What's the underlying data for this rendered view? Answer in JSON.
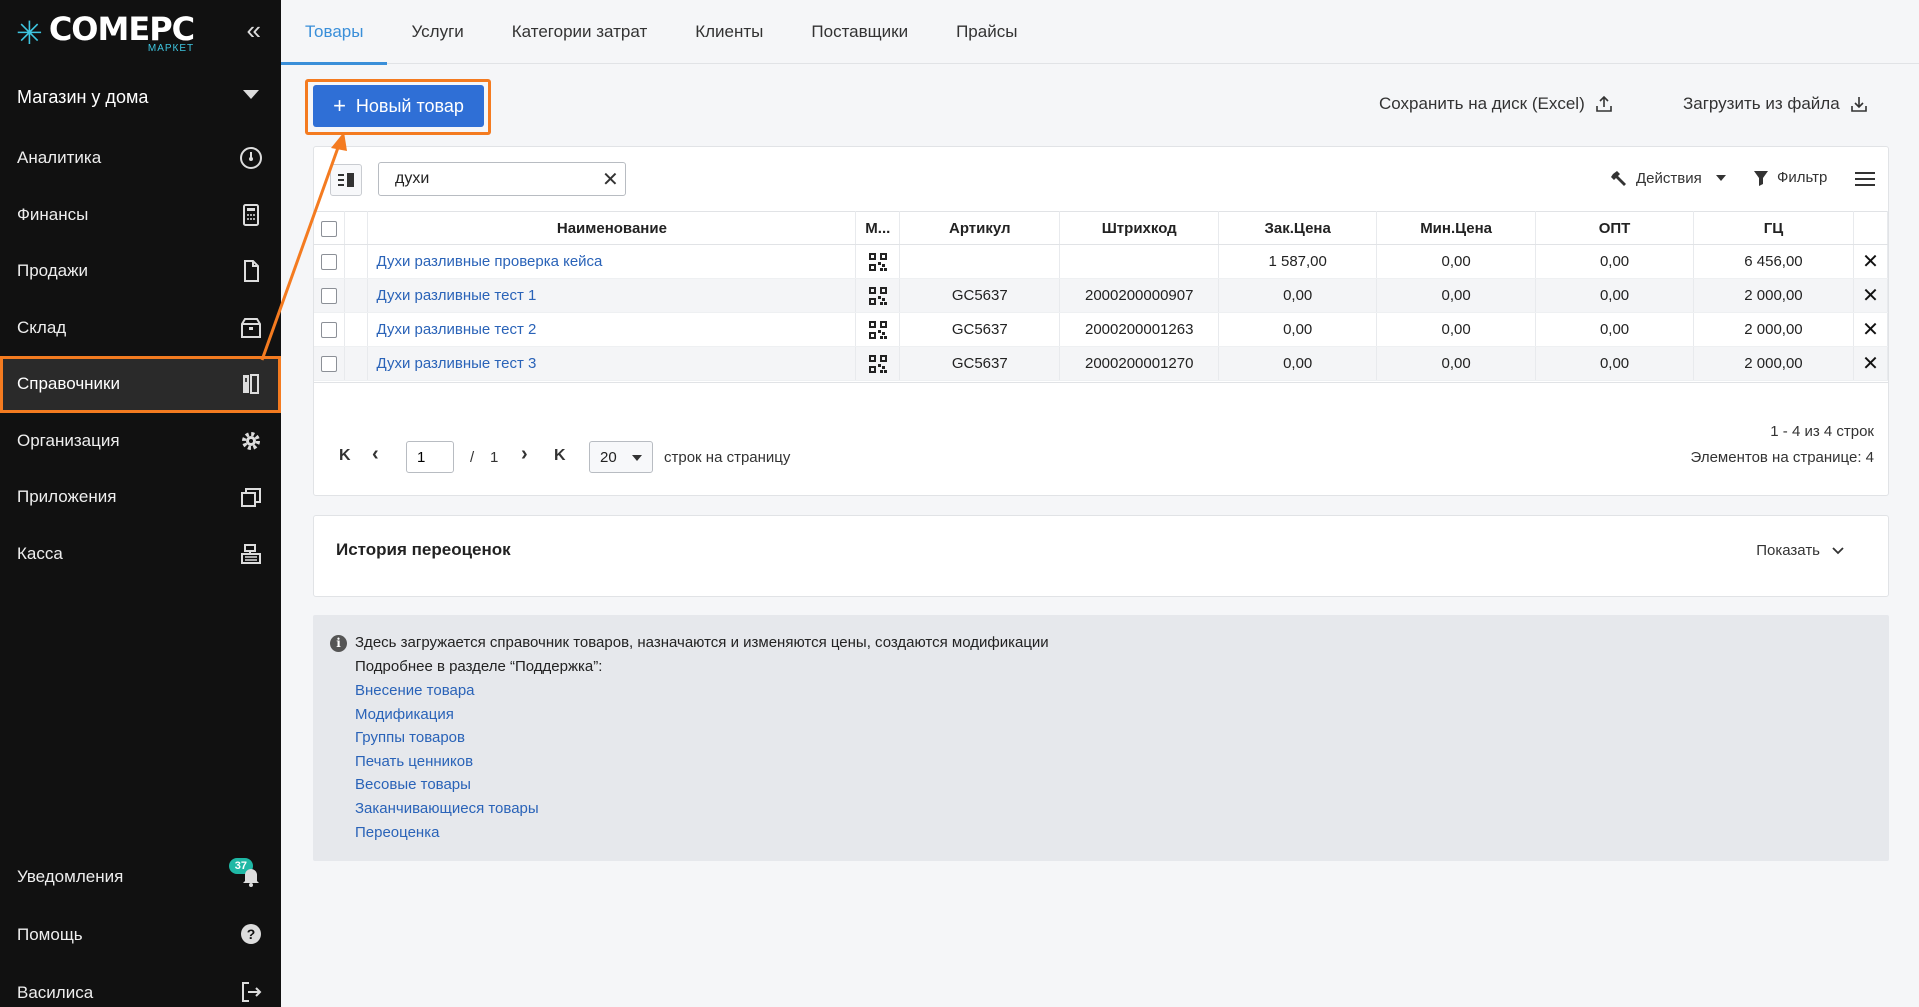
{
  "sidebar": {
    "logo_main": "COMEPC",
    "logo_sub": "МАРКЕТ",
    "store": "Магазин у дома",
    "items": [
      {
        "label": "Аналитика",
        "icon": "speedometer-icon"
      },
      {
        "label": "Финансы",
        "icon": "calculator-icon"
      },
      {
        "label": "Продажи",
        "icon": "document-icon"
      },
      {
        "label": "Склад",
        "icon": "box-icon"
      },
      {
        "label": "Справочники",
        "icon": "books-icon",
        "active": true
      },
      {
        "label": "Организация",
        "icon": "gear-icon"
      },
      {
        "label": "Приложения",
        "icon": "windows-icon"
      },
      {
        "label": "Касса",
        "icon": "cash-register-icon"
      }
    ],
    "bottom": [
      {
        "label": "Уведомления",
        "icon": "bell-icon",
        "badge": "37"
      },
      {
        "label": "Помощь",
        "icon": "help-icon"
      },
      {
        "label": "Василиса",
        "icon": "logout-icon"
      }
    ]
  },
  "tabs": [
    "Товары",
    "Услуги",
    "Категории затрат",
    "Клиенты",
    "Поставщики",
    "Прайсы"
  ],
  "toolbar": {
    "new_button": "Новый товар",
    "save_disk": "Сохранить на диск (Excel)",
    "load_file": "Загрузить из файла"
  },
  "grid": {
    "search_value": "духи",
    "actions_label": "Действия",
    "filter_label": "Фильтр",
    "columns": [
      "Наименование",
      "М...",
      "Артикул",
      "Штрихкод",
      "Зак.Цена",
      "Мин.Цена",
      "ОПТ",
      "ГЦ"
    ],
    "rows": [
      {
        "name": "Духи разливные проверка кейса",
        "article": "",
        "barcode": "",
        "buy": "1 587,00",
        "min": "0,00",
        "opt": "0,00",
        "gc": "6 456,00"
      },
      {
        "name": "Духи разливные тест 1",
        "article": "GC5637",
        "barcode": "2000200000907",
        "buy": "0,00",
        "min": "0,00",
        "opt": "0,00",
        "gc": "2 000,00"
      },
      {
        "name": "Духи разливные тест 2",
        "article": "GC5637",
        "barcode": "2000200001263",
        "buy": "0,00",
        "min": "0,00",
        "opt": "0,00",
        "gc": "2 000,00"
      },
      {
        "name": "Духи разливные тест 3",
        "article": "GC5637",
        "barcode": "2000200001270",
        "buy": "0,00",
        "min": "0,00",
        "opt": "0,00",
        "gc": "2 000,00"
      }
    ]
  },
  "pager": {
    "first": "K",
    "prev": "‹",
    "page": "1",
    "of": "/",
    "total_pages": "1",
    "next": "›",
    "last": "K",
    "page_size": "20",
    "page_size_label": "строк на страницу",
    "range_text": "1 - 4 из 4 строк",
    "per_page_text": "Элементов на странице: 4"
  },
  "history": {
    "title": "История переоценок",
    "show": "Показать"
  },
  "info": {
    "line1": "Здесь загружается справочник товаров, назначаются и изменяются цены, создаются модификации",
    "line2": "Подробнее в разделе “Поддержка”:",
    "links": [
      "Внесение товара",
      "Модификация",
      "Группы товаров",
      "Печать ценников",
      "Весовые товары",
      "Заканчивающиеся товары",
      "Переоценка"
    ]
  },
  "colors": {
    "accent": "#2f6fd6",
    "tab_active": "#3a8fd9",
    "highlight": "#f47b20",
    "badge": "#1fb8a5"
  }
}
